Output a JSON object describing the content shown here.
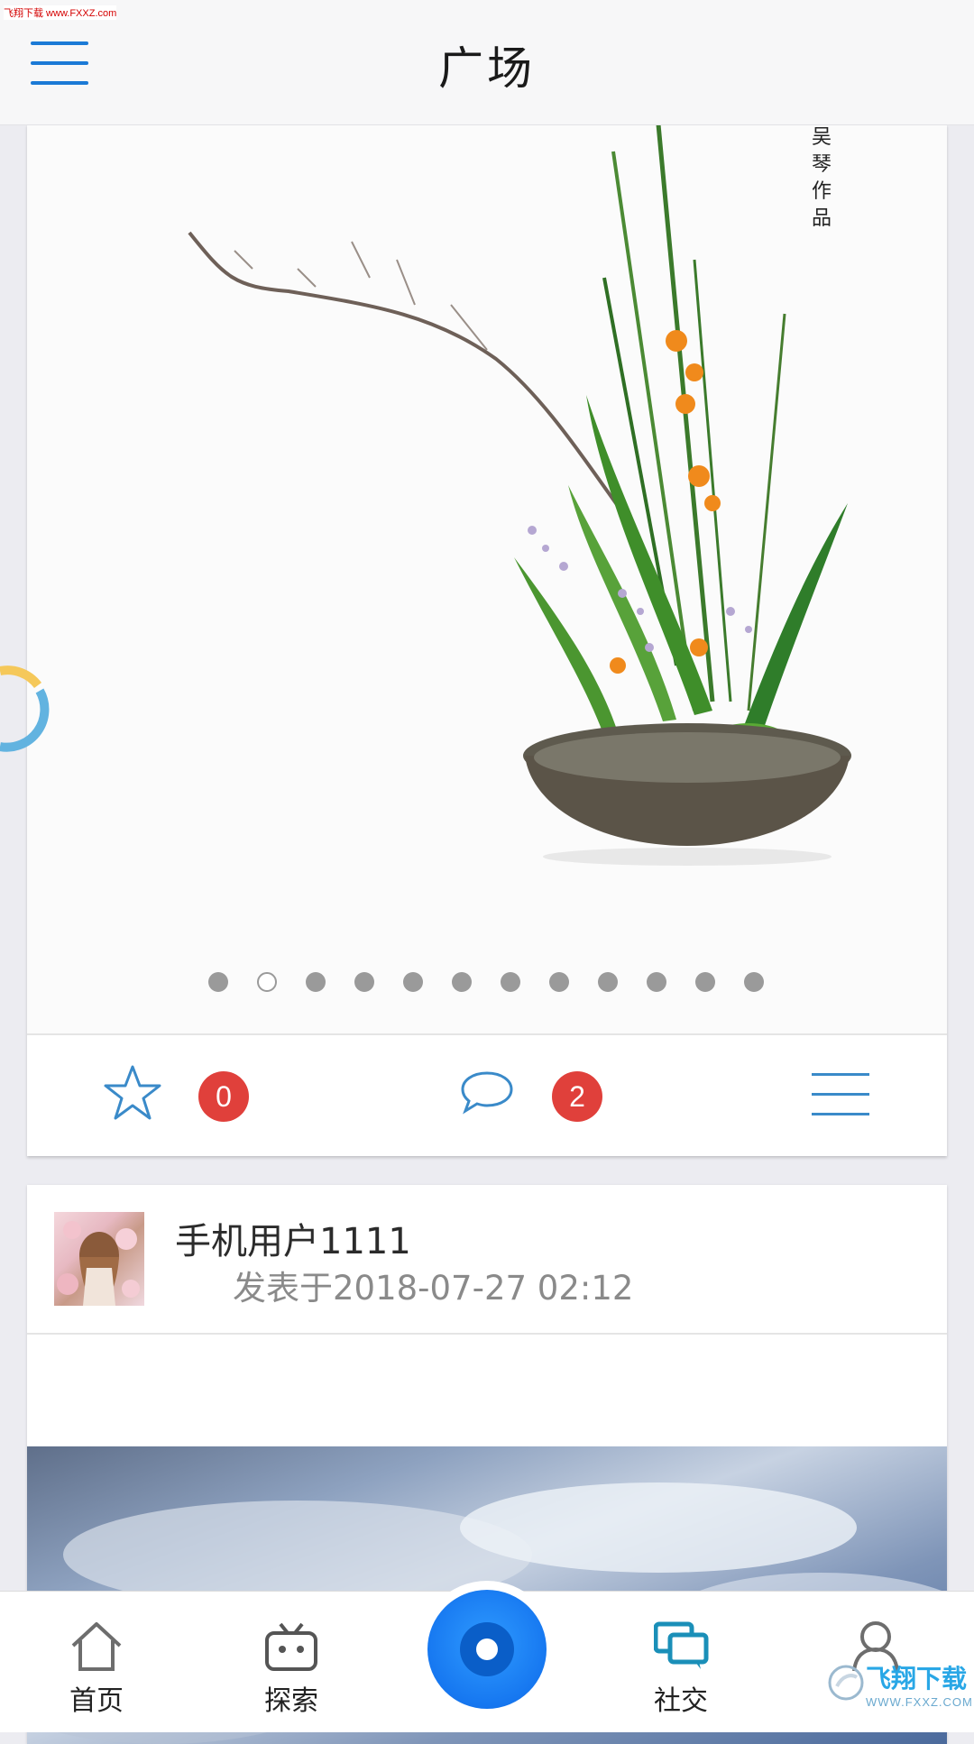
{
  "watermark_top": "飞翔下载 www.FXXZ.com",
  "header": {
    "title": "广场"
  },
  "feed": {
    "post1": {
      "author_stamp": "吴琴作品",
      "carousel": {
        "total": 12,
        "active_index": 1
      },
      "actions": {
        "favorite_count": "0",
        "comment_count": "2"
      }
    },
    "post2": {
      "username": "手机用户1111",
      "time": "发表于2018-07-27 02:12"
    }
  },
  "bottom_nav": {
    "items": [
      {
        "label": "首页",
        "icon": "home-icon"
      },
      {
        "label": "探索",
        "icon": "tv-icon"
      },
      {
        "label": "",
        "icon": "record-icon"
      },
      {
        "label": "社交",
        "icon": "chat-icon"
      },
      {
        "label": "",
        "icon": "user-icon"
      }
    ]
  },
  "brand_watermark": {
    "text": "飞翔下载",
    "sub": "WWW.FXXZ.COM"
  },
  "colors": {
    "accent": "#1b7ad6",
    "badge": "#e0403b",
    "active_nav": "#1a8fb8"
  }
}
